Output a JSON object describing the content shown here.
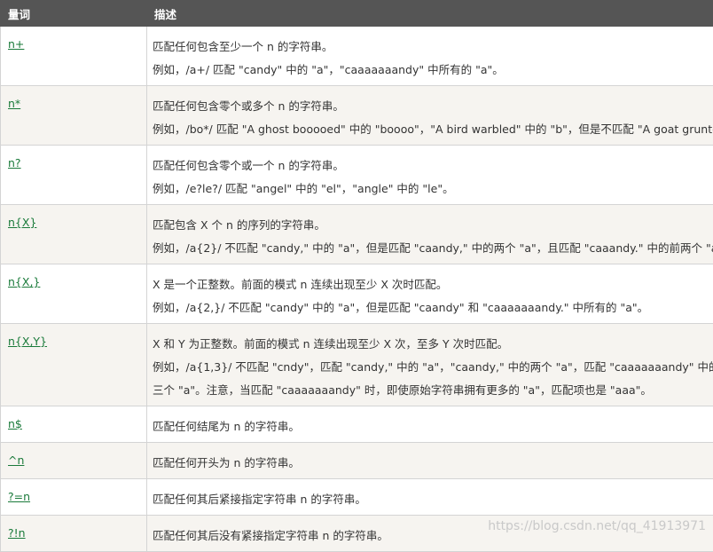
{
  "header": {
    "col1": "量词",
    "col2": "描述"
  },
  "rows": [
    {
      "key": "n+",
      "lines": [
        "匹配任何包含至少一个 n 的字符串。",
        "例如，/a+/ 匹配 \"candy\" 中的 \"a\"，\"caaaaaaandy\" 中所有的 \"a\"。"
      ]
    },
    {
      "key": "n*",
      "lines": [
        "匹配任何包含零个或多个 n 的字符串。",
        "例如，/bo*/ 匹配 \"A ghost booooed\" 中的 \"boooo\"，\"A bird warbled\" 中的 \"b\"，但是不匹配 \"A goat grunted\"。"
      ]
    },
    {
      "key": "n?",
      "lines": [
        "匹配任何包含零个或一个 n 的字符串。",
        "例如，/e?le?/ 匹配 \"angel\" 中的 \"el\"，\"angle\" 中的 \"le\"。"
      ]
    },
    {
      "key": "n{X}",
      "lines": [
        "匹配包含 X 个 n 的序列的字符串。",
        "例如，/a{2}/ 不匹配 \"candy,\" 中的 \"a\"，但是匹配 \"caandy,\" 中的两个 \"a\"，且匹配 \"caaandy.\" 中的前两个 \"a\"。"
      ]
    },
    {
      "key": "n{X,}",
      "lines": [
        "X 是一个正整数。前面的模式 n 连续出现至少 X 次时匹配。",
        "例如，/a{2,}/ 不匹配 \"candy\" 中的 \"a\"，但是匹配 \"caandy\" 和 \"caaaaaaandy.\" 中所有的 \"a\"。"
      ]
    },
    {
      "key": "n{X,Y}",
      "lines": [
        "X 和 Y 为正整数。前面的模式 n 连续出现至少 X 次，至多 Y 次时匹配。",
        "例如，/a{1,3}/ 不匹配 \"cndy\"，匹配 \"candy,\" 中的 \"a\"，\"caandy,\" 中的两个 \"a\"，匹配 \"caaaaaaandy\" 中的前面",
        "三个 \"a\"。注意，当匹配 \"caaaaaaandy\" 时，即使原始字符串拥有更多的 \"a\"，匹配项也是 \"aaa\"。"
      ]
    },
    {
      "key": "n$",
      "lines": [
        "匹配任何结尾为 n 的字符串。"
      ]
    },
    {
      "key": "^n",
      "lines": [
        "匹配任何开头为 n 的字符串。"
      ]
    },
    {
      "key": "?=n",
      "lines": [
        "匹配任何其后紧接指定字符串 n 的字符串。"
      ]
    },
    {
      "key": "?!n",
      "lines": [
        "匹配任何其后没有紧接指定字符串 n 的字符串。"
      ]
    }
  ],
  "watermark": "https://blog.csdn.net/qq_41913971",
  "colors": {
    "header_bg": "#555555",
    "link": "#1a7a3a",
    "shade": "#f6f4f0",
    "border": "#d4d4d4"
  }
}
